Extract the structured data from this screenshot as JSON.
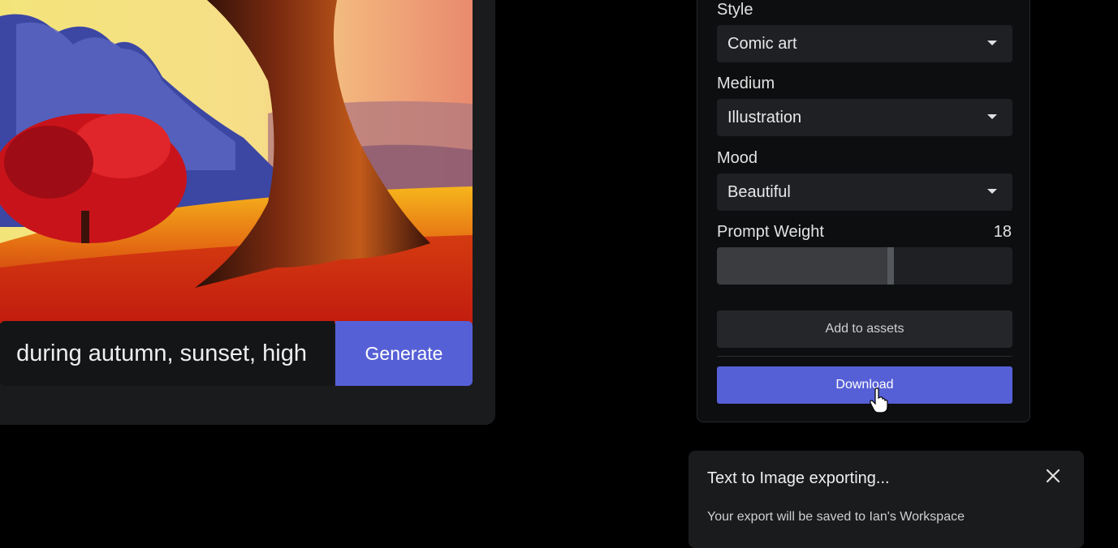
{
  "prompt": {
    "text": "during autumn, sunset, high",
    "generate_label": "Generate"
  },
  "settings": {
    "style": {
      "label": "Style",
      "value": "Comic art"
    },
    "medium": {
      "label": "Medium",
      "value": "Illustration"
    },
    "mood": {
      "label": "Mood",
      "value": "Beautiful"
    },
    "prompt_weight": {
      "label": "Prompt Weight",
      "value": "18",
      "fill_fraction": 0.6
    },
    "add_to_assets_label": "Add to assets",
    "download_label": "Download"
  },
  "toast": {
    "title": "Text to Image exporting...",
    "message": "Your export will be saved to Ian's Workspace"
  },
  "colors": {
    "accent": "#5660d6",
    "background": "#000000",
    "panel": "#0d0e10"
  },
  "icons": {
    "select_caret": "caret-down-icon",
    "close": "close-icon",
    "cursor": "hand-pointer-icon"
  }
}
